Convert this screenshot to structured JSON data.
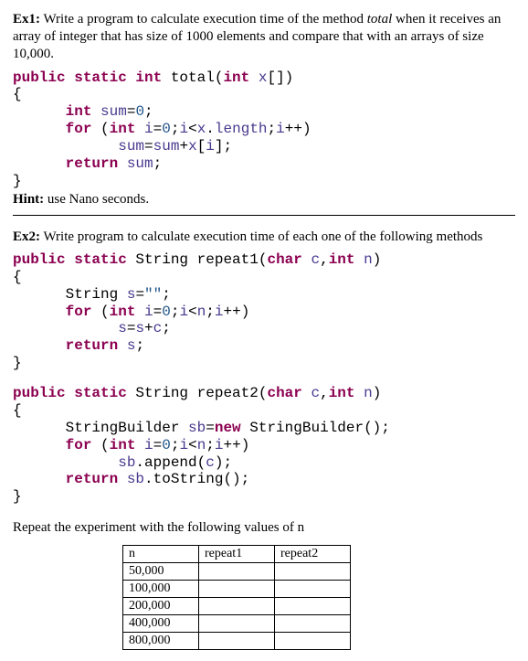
{
  "ex1": {
    "label": "Ex1:",
    "text_before_ital": " Write a program to calculate execution time of the method ",
    "ital": "total",
    "text_after_ital": " when it receives an array of integer that has size of 1000 elements and compare that with an arrays of size 10,000."
  },
  "code1": {
    "l1_a": "public static int ",
    "l1_b": "total",
    "l1_c": "(",
    "l1_d": "int ",
    "l1_e": "x",
    "l1_f": "[])",
    "l2": "{",
    "l3_a": "      int ",
    "l3_b": "sum",
    "l3_c": "=",
    "l3_d": "0",
    "l3_e": ";",
    "l4_a": "      for ",
    "l4_b": "(",
    "l4_c": "int ",
    "l4_d": "i",
    "l4_e": "=",
    "l4_f": "0",
    "l4_g": ";",
    "l4_h": "i",
    "l4_i": "<",
    "l4_j": "x",
    "l4_k": ".",
    "l4_l": "length",
    "l4_m": ";",
    "l4_n": "i",
    "l4_o": "++)",
    "l5_a": "            sum",
    "l5_b": "=",
    "l5_c": "sum",
    "l5_d": "+",
    "l5_e": "x",
    "l5_f": "[",
    "l5_g": "i",
    "l5_h": "];",
    "l6_a": "      return ",
    "l6_b": "sum",
    "l6_c": ";",
    "l7": "}"
  },
  "hint": {
    "label": "Hint:",
    "text": " use Nano seconds."
  },
  "ex2": {
    "label": "Ex2:",
    "text": " Write program to calculate execution time of each one of the following methods"
  },
  "code2a": {
    "l1_a": "public static ",
    "l1_b": "String ",
    "l1_c": "repeat1",
    "l1_d": "(",
    "l1_e": "char ",
    "l1_f": "c",
    "l1_g": ",",
    "l1_h": "int ",
    "l1_i": "n",
    "l1_j": ")",
    "l2": "{",
    "l3_a": "      String ",
    "l3_b": "s",
    "l3_c": "=",
    "l3_d": "\"\"",
    "l3_e": ";",
    "l4_a": "      for ",
    "l4_b": "(",
    "l4_c": "int ",
    "l4_d": "i",
    "l4_e": "=",
    "l4_f": "0",
    "l4_g": ";",
    "l4_h": "i",
    "l4_i": "<",
    "l4_j": "n",
    "l4_k": ";",
    "l4_l": "i",
    "l4_m": "++)",
    "l5_a": "            s",
    "l5_b": "=",
    "l5_c": "s",
    "l5_d": "+",
    "l5_e": "c",
    "l5_f": ";",
    "l6_a": "      return ",
    "l6_b": "s",
    "l6_c": ";",
    "l7": "}"
  },
  "code2b": {
    "l1_a": "public static ",
    "l1_b": "String ",
    "l1_c": "repeat2",
    "l1_d": "(",
    "l1_e": "char ",
    "l1_f": "c",
    "l1_g": ",",
    "l1_h": "int ",
    "l1_i": "n",
    "l1_j": ")",
    "l2": "{",
    "l3_a": "      StringBuilder ",
    "l3_b": "sb",
    "l3_c": "=",
    "l3_d": "new ",
    "l3_e": "StringBuilder();",
    "l4_a": "      for ",
    "l4_b": "(",
    "l4_c": "int ",
    "l4_d": "i",
    "l4_e": "=",
    "l4_f": "0",
    "l4_g": ";",
    "l4_h": "i",
    "l4_i": "<",
    "l4_j": "n",
    "l4_k": ";",
    "l4_l": "i",
    "l4_m": "++)",
    "l5_a": "            sb",
    "l5_b": ".append(",
    "l5_c": "c",
    "l5_d": ");",
    "l6_a": "      return ",
    "l6_b": "sb",
    "l6_c": ".toString();",
    "l7": "}"
  },
  "repeat_note": "Repeat the experiment with the following values of n",
  "table": {
    "headers": [
      "n",
      "repeat1",
      "repeat2"
    ],
    "rows": [
      [
        "50,000",
        "",
        ""
      ],
      [
        "100,000",
        "",
        ""
      ],
      [
        "200,000",
        "",
        ""
      ],
      [
        "400,000",
        "",
        ""
      ],
      [
        "800,000",
        "",
        ""
      ]
    ]
  }
}
